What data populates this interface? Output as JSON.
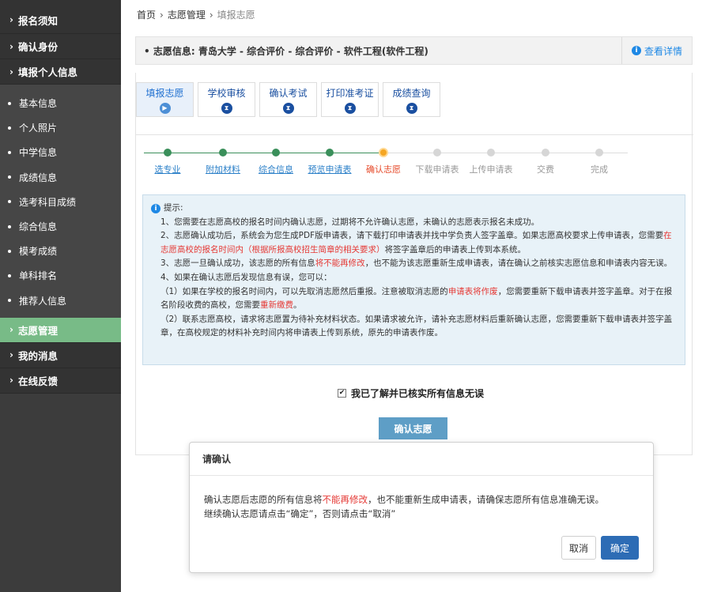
{
  "sidebar": {
    "sections": [
      {
        "label": "报名须知"
      },
      {
        "label": "确认身份"
      },
      {
        "label": "填报个人信息"
      }
    ],
    "sub_items": [
      {
        "label": "基本信息"
      },
      {
        "label": "个人照片"
      },
      {
        "label": "中学信息"
      },
      {
        "label": "成绩信息"
      },
      {
        "label": "选考科目成绩"
      },
      {
        "label": "综合信息"
      },
      {
        "label": "模考成绩"
      },
      {
        "label": "单科排名"
      },
      {
        "label": "推荐人信息"
      }
    ],
    "bottom_sections": [
      {
        "label": "志愿管理",
        "active": true
      },
      {
        "label": "我的消息"
      },
      {
        "label": "在线反馈"
      }
    ],
    "colors": {
      "bg": "#3c3c3c",
      "active": "#78bb87"
    }
  },
  "breadcrumb": {
    "home": "首页",
    "section": "志愿管理",
    "current": "填报志愿",
    "sep": "›"
  },
  "info_bar": {
    "text": "志愿信息:  青岛大学 - 综合评价 - 综合评价 - 软件工程(软件工程)",
    "detail_label": "查看详情"
  },
  "tabs": [
    {
      "label": "填报志愿",
      "active": true
    },
    {
      "label": "学校审核"
    },
    {
      "label": "确认考试"
    },
    {
      "label": "打印准考证"
    },
    {
      "label": "成绩查询"
    }
  ],
  "steps": [
    {
      "label": "选专业",
      "state": "done"
    },
    {
      "label": "附加材料",
      "state": "done"
    },
    {
      "label": "综合信息",
      "state": "done"
    },
    {
      "label": "预览申请表",
      "state": "done"
    },
    {
      "label": "确认志愿",
      "state": "current"
    },
    {
      "label": "下载申请表",
      "state": "todo"
    },
    {
      "label": "上传申请表",
      "state": "todo"
    },
    {
      "label": "交费",
      "state": "todo"
    },
    {
      "label": "完成",
      "state": "todo"
    }
  ],
  "tip": {
    "title": "提示:",
    "l1": "1、您需要在志愿高校的报名时间内确认志愿，过期将不允许确认志愿，未确认的志愿表示报名未成功。",
    "l2a": "2、志愿确认成功后，系统会为您生成PDF版申请表，请下载打印申请表并找中学负责人签字盖章。如果志愿高校要求上传申请表，您需要",
    "l2red": "在志愿高校的报名时间内（根据所报高校招生简章的相关要求）",
    "l2b": "将签字盖章后的申请表上传到本系统。",
    "l3a": "3、志愿一旦确认成功，该志愿的所有信息",
    "l3red": "将不能再修改",
    "l3b": "，也不能为该志愿重新生成申请表，请在确认之前核实志愿信息和申请表内容无误。",
    "l4": "4、如果在确认志愿后发现信息有误，您可以：",
    "l5a": "（1）如果在学校的报名时间内，可以先取消志愿然后重报。注意被取消志愿的",
    "l5red": "申请表将作废",
    "l5b": "，您需要重新下载申请表并签字盖章。对于在报名阶段收费的高校，您需要",
    "l5red2": "重新缴费",
    "l5c": "。",
    "l6": "（2）联系志愿高校，请求将志愿置为待补充材料状态。如果请求被允许，请补充志愿材料后重新确认志愿，您需要重新下载申请表并签字盖章，在高校规定的材料补充时间内将申请表上传到系统，原先的申请表作废。"
  },
  "agree": {
    "label": "我已了解并已核实所有信息无误",
    "checked": "✔"
  },
  "confirm_button": "确认志愿",
  "dialog": {
    "title": "请确认",
    "line1a": "确认志愿后志愿的所有信息将",
    "line1red": "不能再修改",
    "line1b": "，也不能重新生成申请表，请确保志愿所有信息准确无误。",
    "line2": "继续确认志愿请点击“确定”，否则请点击“取消”",
    "cancel": "取消",
    "ok": "确定"
  }
}
